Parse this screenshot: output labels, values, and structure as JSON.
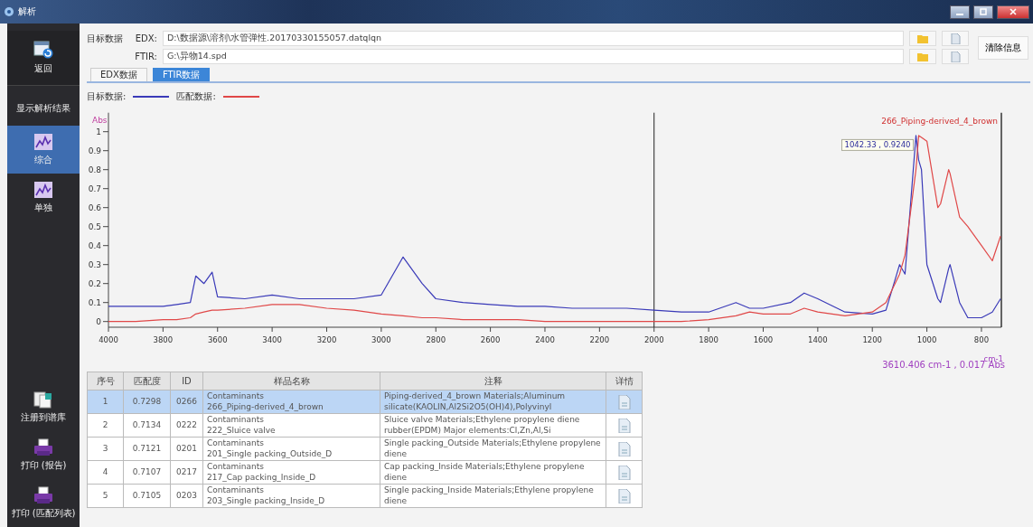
{
  "window": {
    "title": "解析"
  },
  "sidebar": {
    "back": {
      "label": "返回"
    },
    "section_title": "显示解析结果",
    "views": [
      {
        "label": "综合",
        "selected": true
      },
      {
        "label": "单独",
        "selected": false
      }
    ],
    "actions": [
      {
        "label": "注册到谱库",
        "kind": "register"
      },
      {
        "label": "打印 (报告)",
        "kind": "print"
      },
      {
        "label": "打印 (匹配列表)",
        "kind": "print"
      }
    ]
  },
  "source": {
    "label": "目标数据",
    "files": [
      {
        "label": "EDX:",
        "path": "D:\\数据源\\溶剂\\水管弹性.20170330155057.datqlqn"
      },
      {
        "label": "FTIR:",
        "path": "G:\\异物14.spd"
      }
    ],
    "clear_button": "清除信息"
  },
  "tabs": [
    {
      "label": "EDX数据",
      "selected": false
    },
    {
      "label": "FTIR数据",
      "selected": true
    }
  ],
  "spectrum": {
    "readout": "3610.406 cm-1 , 0.017 Abs",
    "chart_data": {
      "type": "line",
      "xlabel": "cm-1",
      "ylabel": "Abs",
      "xlim": [
        4000,
        727
      ],
      "ylim": [
        -0.03,
        1.1
      ],
      "xticks": [
        4000,
        3800,
        3600,
        3400,
        3200,
        3000,
        2800,
        2600,
        2400,
        2200,
        2000,
        1800,
        1600,
        1400,
        1200,
        1000,
        800
      ],
      "yticks": [
        0,
        0.1,
        0.2,
        0.3,
        0.4,
        0.5,
        0.6,
        0.7,
        0.8,
        0.9,
        1
      ],
      "x": [
        4000,
        3900,
        3800,
        3750,
        3700,
        3680,
        3650,
        3620,
        3600,
        3500,
        3400,
        3300,
        3200,
        3100,
        3000,
        2920,
        2850,
        2800,
        2700,
        2600,
        2500,
        2400,
        2300,
        2200,
        2100,
        2000,
        1900,
        1800,
        1700,
        1650,
        1600,
        1500,
        1450,
        1400,
        1300,
        1200,
        1150,
        1100,
        1080,
        1040,
        1030,
        1020,
        1000,
        960,
        950,
        920,
        915,
        880,
        850,
        800,
        760,
        730
      ],
      "series": [
        {
          "name": "目标数据:",
          "color": "#3a3ab8",
          "values": [
            0.08,
            0.08,
            0.08,
            0.09,
            0.1,
            0.24,
            0.2,
            0.26,
            0.13,
            0.12,
            0.14,
            0.12,
            0.12,
            0.12,
            0.14,
            0.34,
            0.2,
            0.12,
            0.1,
            0.09,
            0.08,
            0.08,
            0.07,
            0.07,
            0.07,
            0.06,
            0.05,
            0.05,
            0.1,
            0.07,
            0.07,
            0.1,
            0.15,
            0.12,
            0.05,
            0.04,
            0.06,
            0.3,
            0.25,
            0.98,
            0.85,
            0.8,
            0.3,
            0.12,
            0.1,
            0.28,
            0.3,
            0.1,
            0.02,
            0.02,
            0.05,
            0.12
          ]
        },
        {
          "name": "匹配数据:",
          "color": "#e04848",
          "values": [
            0,
            0,
            0.01,
            0.01,
            0.02,
            0.04,
            0.05,
            0.06,
            0.06,
            0.07,
            0.09,
            0.09,
            0.07,
            0.06,
            0.04,
            0.03,
            0.02,
            0.02,
            0.01,
            0.01,
            0.01,
            0,
            0,
            0,
            0,
            0,
            0,
            0.01,
            0.03,
            0.05,
            0.04,
            0.04,
            0.07,
            0.05,
            0.03,
            0.05,
            0.1,
            0.25,
            0.35,
            0.8,
            0.98,
            0.97,
            0.95,
            0.6,
            0.62,
            0.8,
            0.78,
            0.55,
            0.5,
            0.4,
            0.32,
            0.45
          ]
        }
      ],
      "ref_lines": [
        {
          "axis": "x",
          "value": 2000
        }
      ],
      "annotations": [
        "266_Piping-derived_4_brown",
        "1042.33 , 0.9240"
      ]
    }
  },
  "results": {
    "columns": [
      "序号",
      "匹配度",
      "ID",
      "样品名称",
      "注释",
      "详情"
    ],
    "rows": [
      {
        "index": "1",
        "score": "0.7298",
        "id": "0266",
        "category": "Contaminants",
        "name": "266_Piping-derived_4_brown",
        "note": "Piping-derived_4_brown Materials;Aluminum silicate(KAOLIN,Al2Si2O5(OH)4),Polyvinyl",
        "selected": true
      },
      {
        "index": "2",
        "score": "0.7134",
        "id": "0222",
        "category": "Contaminants",
        "name": "222_Sluice valve",
        "note": "Sluice valve Materials;Ethylene propylene diene rubber(EPDM) Major elements:Cl,Zn,Al,Si",
        "selected": false
      },
      {
        "index": "3",
        "score": "0.7121",
        "id": "0201",
        "category": "Contaminants",
        "name": "201_Single packing_Outside_D",
        "note": "Single packing_Outside Materials;Ethylene propylene diene",
        "selected": false
      },
      {
        "index": "4",
        "score": "0.7107",
        "id": "0217",
        "category": "Contaminants",
        "name": "217_Cap packing_Inside_D",
        "note": "Cap packing_Inside Materials;Ethylene propylene diene",
        "selected": false
      },
      {
        "index": "5",
        "score": "0.7105",
        "id": "0203",
        "category": "Contaminants",
        "name": "203_Single packing_Inside_D",
        "note": "Single packing_Inside Materials;Ethylene propylene diene",
        "selected": false
      }
    ]
  }
}
